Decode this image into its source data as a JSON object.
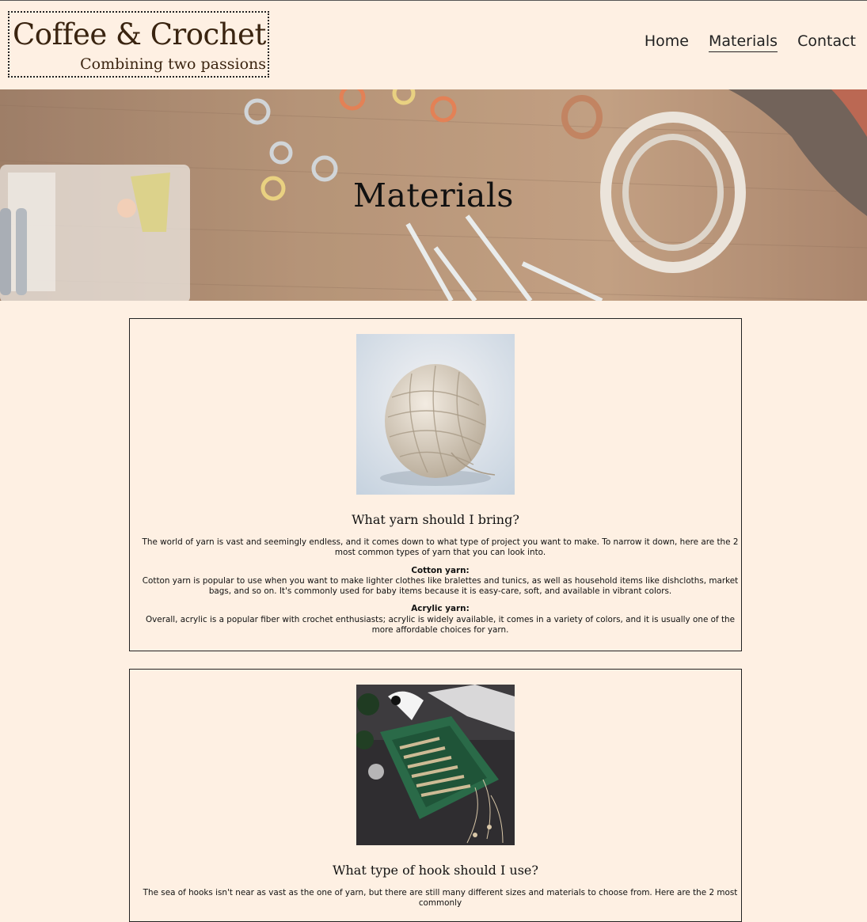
{
  "site": {
    "title": "Coffee & Crochet",
    "subtitle": "Combining two passions"
  },
  "nav": {
    "items": [
      "Home",
      "Materials",
      "Contact"
    ],
    "active": "Materials"
  },
  "hero": {
    "title": "Materials"
  },
  "sections": [
    {
      "heading": "What yarn should I bring?",
      "intro": "The world of yarn is vast and seemingly endless, and it comes down to what type of project you want to make. To narrow it down, here are the 2 most common types of yarn that you can look into.",
      "items": [
        {
          "label": "Cotton yarn:",
          "text": "Cotton yarn is popular to use when you want to make lighter clothes like bralettes and tunics, as well as household items like dishcloths, market bags, and so on. It's commonly used for baby items because it is easy-care, soft, and available in vibrant colors."
        },
        {
          "label": "Acrylic yarn:",
          "text": "Overall, acrylic is a popular fiber with crochet enthusiasts; acrylic is widely available, it comes in a variety of colors, and it is usually one of the more affordable choices for yarn."
        }
      ]
    },
    {
      "heading": "What type of hook should I use?",
      "intro": "The sea of hooks isn't near as vast as the one of yarn, but there are still many different sizes and materials to choose from. Here are the 2 most commonly"
    }
  ],
  "colors": {
    "background": "#fef0e3",
    "text": "#3a2410",
    "border": "#222222"
  }
}
